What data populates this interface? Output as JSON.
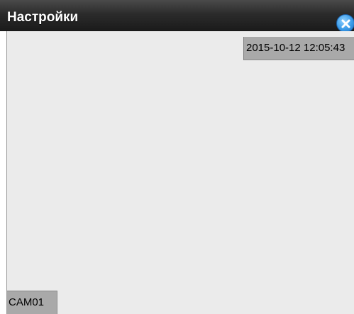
{
  "window": {
    "title": "Настройки",
    "close_icon": "close-icon"
  },
  "video": {
    "timestamp": "2015-10-12  12:05:43",
    "camera_label": "CAM01"
  },
  "colors": {
    "titlebar": "#2b2b2b",
    "video_background": "#ebebeb",
    "overlay_background": "#a9a9a9",
    "close_button": "#3a9be8"
  }
}
